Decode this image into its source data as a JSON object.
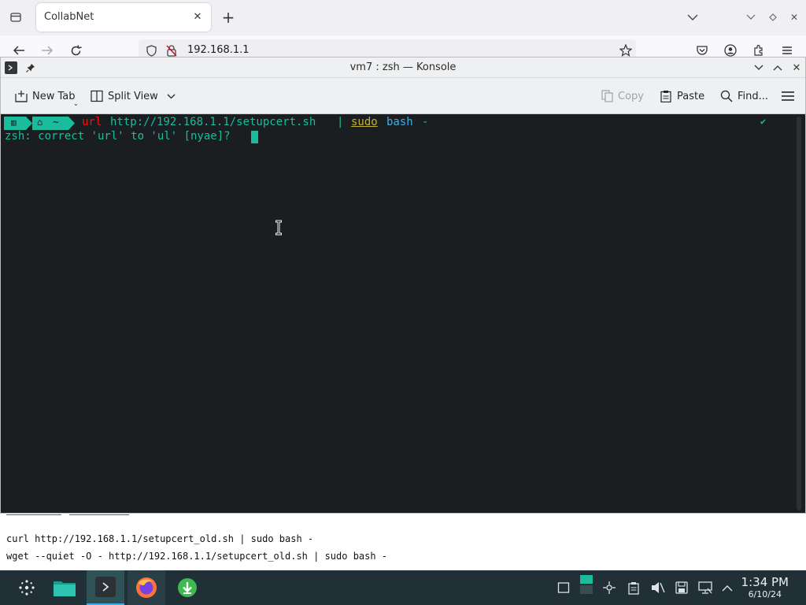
{
  "browser": {
    "tab_title": "CollabNet",
    "url": "192.168.1.1"
  },
  "konsole": {
    "title": "vm7 : zsh — Konsole",
    "toolbar": {
      "new_tab": "New Tab",
      "split_view": "Split View",
      "copy": "Copy",
      "paste": "Paste",
      "find": "Find..."
    },
    "terminal": {
      "prompt_home": "~",
      "cmd_word": "url",
      "cmd_url": "http://192.168.1.1/setupcert.sh",
      "pipe": "|",
      "sudo": "sudo",
      "bash": "bash",
      "dash": "-",
      "status_check": "✔",
      "correction_line": "zsh: correct 'url' to 'ul' [nyae]?"
    }
  },
  "page": {
    "line1": "curl http://192.168.1.1/setupcert_old.sh | sudo bash -",
    "line2": "wget --quiet -O - http://192.168.1.1/setupcert_old.sh | sudo bash -"
  },
  "taskbar": {
    "time": "1:34 PM",
    "date": "6/10/24"
  },
  "colors": {
    "terminal_bg": "#1b1e20",
    "prompt_teal": "#1abc9c",
    "cmd_red": "#ed1515",
    "url_teal": "#1abc9c",
    "sudo_yellow": "#c4b12f",
    "correction_text": "#1abc9c",
    "taskbar_bg": "#203036"
  }
}
